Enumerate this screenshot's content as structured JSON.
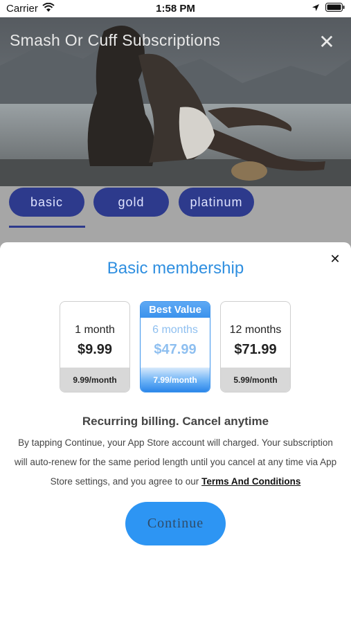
{
  "status_bar": {
    "carrier": "Carrier",
    "time": "1:58 PM",
    "wifi_icon": "wifi-icon",
    "location_icon": "location-arrow-icon",
    "battery_icon": "battery-icon"
  },
  "hero": {
    "title": "Smash Or Cuff Subscriptions",
    "close_glyph": "✕"
  },
  "tabs": [
    {
      "label": "basic"
    },
    {
      "label": "gold"
    },
    {
      "label": "platinum"
    }
  ],
  "sheet": {
    "close_glyph": "✕",
    "title": "Basic membership",
    "plans": [
      {
        "length": "1 month",
        "price": "$9.99",
        "per_month": "9.99/month"
      },
      {
        "badge": "Best Value",
        "length": "6 months",
        "price": "$47.99",
        "per_month": "7.99/month"
      },
      {
        "length": "12 months",
        "price": "$71.99",
        "per_month": "5.99/month"
      }
    ],
    "billing_heading": "Recurring billing. Cancel anytime",
    "legal_text": "By tapping Continue, your App Store account will charged. Your subscription will auto-renew for the same period length until you cancel at any time via App Store settings, and you agree to our",
    "terms_link": "Terms And Conditions",
    "continue_label": "Continue"
  },
  "colors": {
    "accent": "#2f8fe0",
    "tab_bg": "#2d3a8c",
    "continue_bg": "#2d95f3"
  }
}
